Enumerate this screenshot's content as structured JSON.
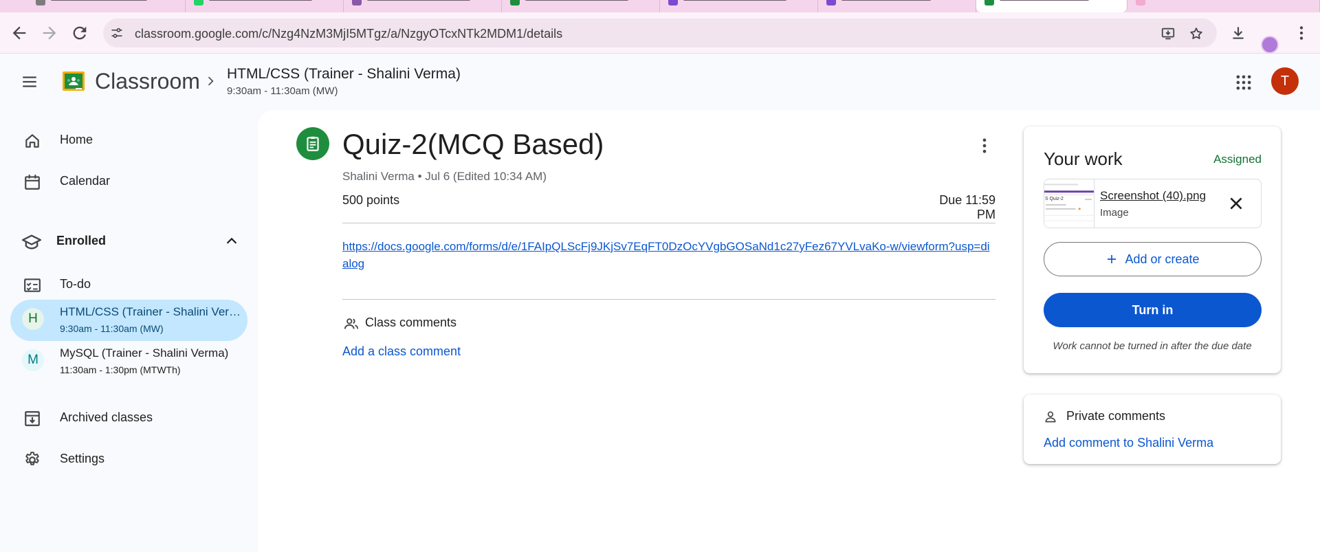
{
  "browser": {
    "url": "classroom.google.com/c/Nzg4NzM3MjI5MTgz/a/NzgyOTcxNTk2MDM1/details"
  },
  "header": {
    "brand": "Classroom",
    "class_title": "HTML/CSS (Trainer - Shalini Verma)",
    "class_time": "9:30am - 11:30am (MW)",
    "avatar_letter": "T"
  },
  "sidebar": {
    "home": "Home",
    "calendar": "Calendar",
    "enrolled": "Enrolled",
    "todo": "To-do",
    "classes": [
      {
        "letter": "H",
        "name": "HTML/CSS (Trainer - Shalini Verma)",
        "time": "9:30am - 11:30am (MW)"
      },
      {
        "letter": "M",
        "name": "MySQL (Trainer - Shalini Verma)",
        "time": "11:30am - 1:30pm (MTWTh)"
      }
    ],
    "archived": "Archived classes",
    "settings": "Settings"
  },
  "assignment": {
    "title": "Quiz-2(MCQ Based)",
    "meta": "Shalini Verma • Jul 6 (Edited 10:34 AM)",
    "points": "500 points",
    "due": "Due 11:59 PM",
    "link": "https://docs.google.com/forms/d/e/1FAIpQLScFj9JKjSv7EqFT0DzOcYVgbGOSaNd1c27yFez67YVLvaKo-w/viewform?usp=dialog",
    "class_comments_label": "Class comments",
    "add_class_comment": "Add a class comment"
  },
  "your_work": {
    "title": "Your work",
    "status": "Assigned",
    "attachment_name": "Screenshot (40).png",
    "attachment_type": "Image",
    "add_or_create": "Add or create",
    "turn_in": "Turn in",
    "note": "Work cannot be turned in after the due date"
  },
  "private_comments": {
    "label": "Private comments",
    "add": "Add comment to Shalini Verma"
  },
  "colors": {
    "accent": "#0b57d0",
    "selected_nav": "#c2e7ff",
    "assignment_icon": "#1e8e3e",
    "status_assigned": "#137333",
    "avatar": "#c4300a"
  }
}
